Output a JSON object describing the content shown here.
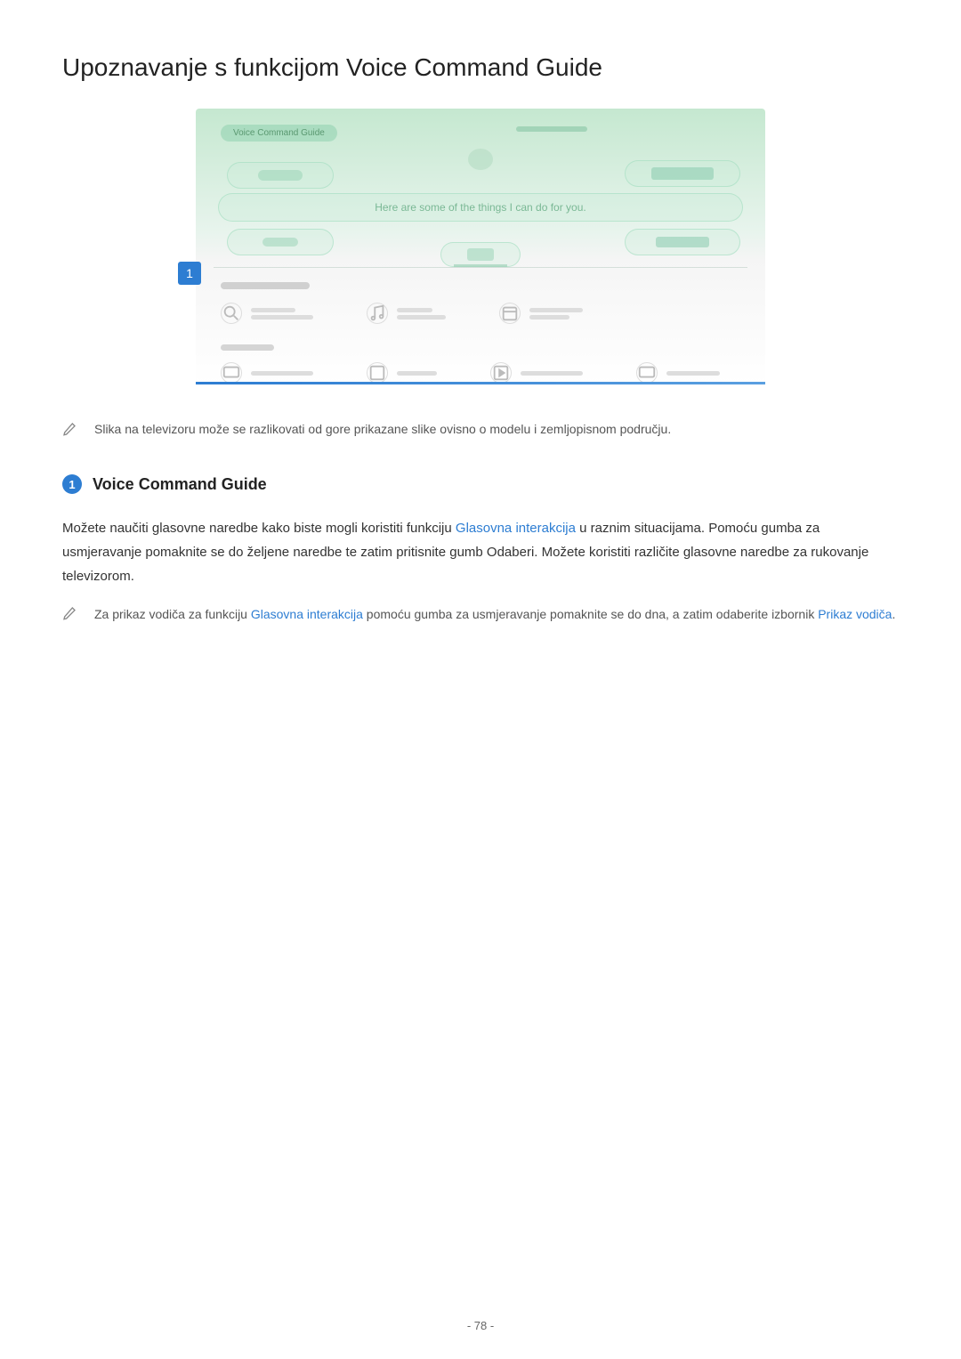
{
  "page": {
    "title": "Upoznavanje s funkcijom Voice Command Guide",
    "number": "- 78 -"
  },
  "screenshot": {
    "header_label": "Voice Command Guide",
    "main_text": "Here are some of the things I can do for you.",
    "badge_number": "1"
  },
  "note1": {
    "text": "Slika na televizoru može se razlikovati od gore prikazane slike ovisno o modelu i zemljopisnom području."
  },
  "section": {
    "number": "1",
    "heading": "Voice Command Guide",
    "body_part1": "Možete naučiti glasovne naredbe kako biste mogli koristiti funkciju ",
    "body_link1": "Glasovna interakcija",
    "body_part2": " u raznim situacijama. Pomoću gumba za usmjeravanje pomaknite se do željene naredbe te zatim pritisnite gumb Odaberi. Možete koristiti različite glasovne naredbe za rukovanje televizorom."
  },
  "note2": {
    "part1": "Za prikaz vodiča za funkciju ",
    "link1": "Glasovna interakcija",
    "part2": " pomoću gumba za usmjeravanje pomaknite se do dna, a zatim odaberite izbornik ",
    "link2": "Prikaz vodiča",
    "part3": "."
  }
}
